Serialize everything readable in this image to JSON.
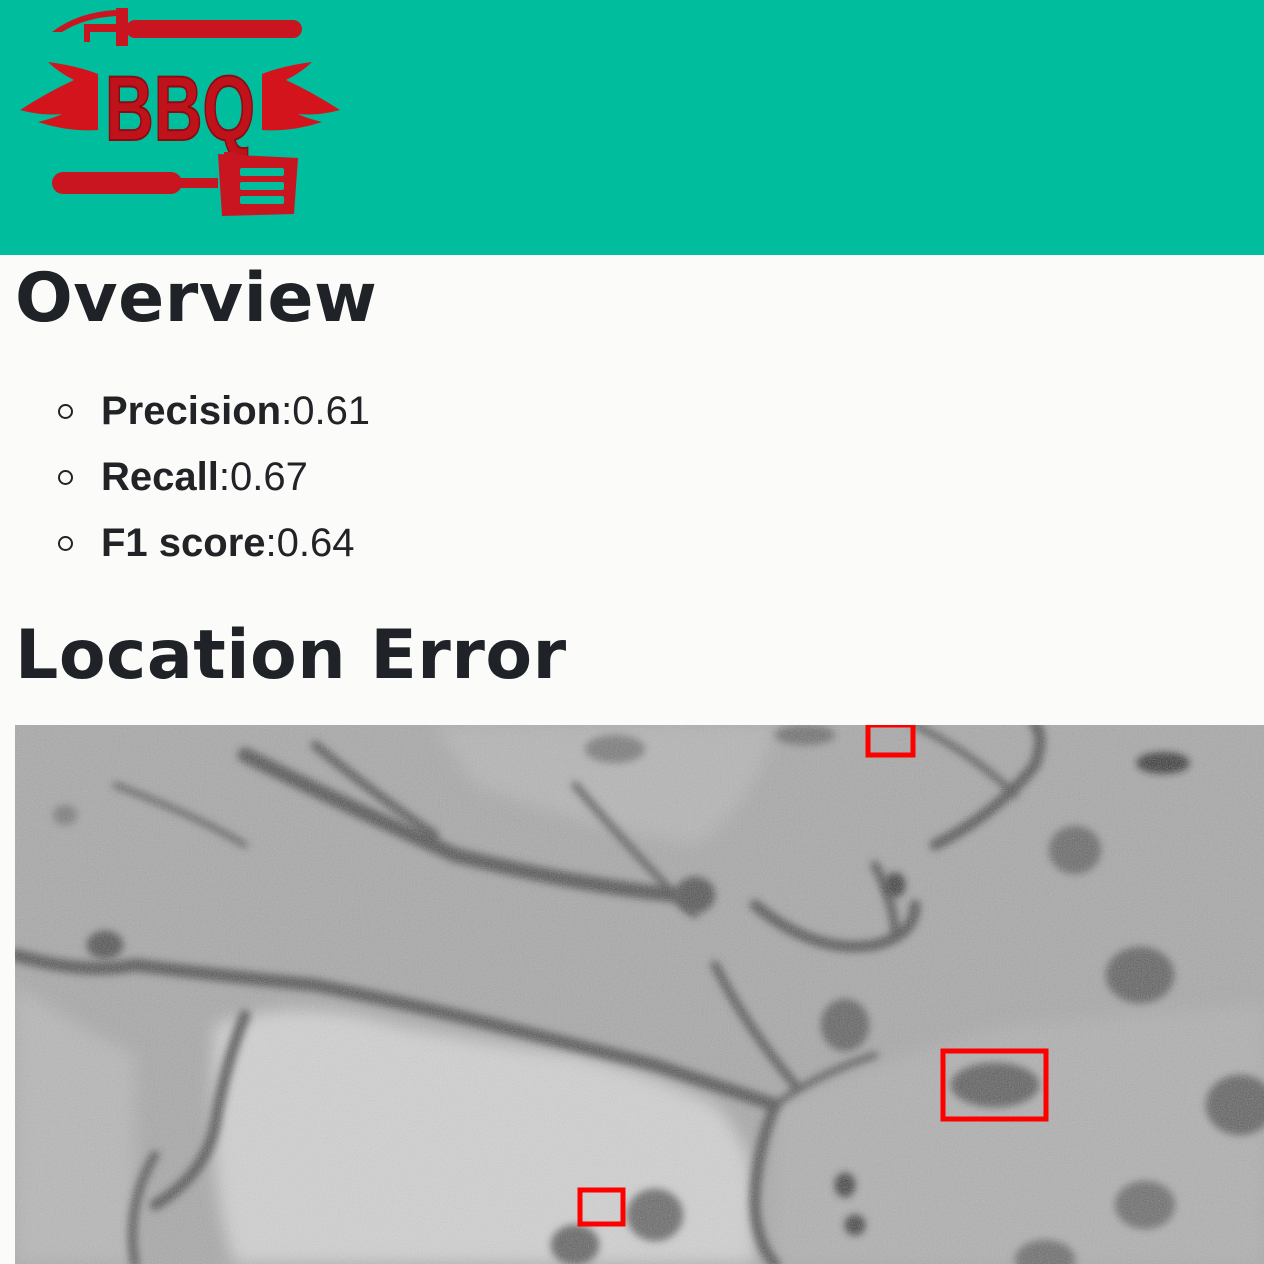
{
  "header": {
    "logo_text": "BBQ",
    "background_color": "#00bd9d",
    "logo_color": "#d3141c"
  },
  "overview": {
    "title": "Overview",
    "metrics": [
      {
        "name": "Precision",
        "value": "0.61"
      },
      {
        "name": "Recall",
        "value": "0.67"
      },
      {
        "name": "F1 score",
        "value": "0.64"
      }
    ]
  },
  "location_error": {
    "title": "Location Error",
    "box_color": "#ff0000"
  }
}
